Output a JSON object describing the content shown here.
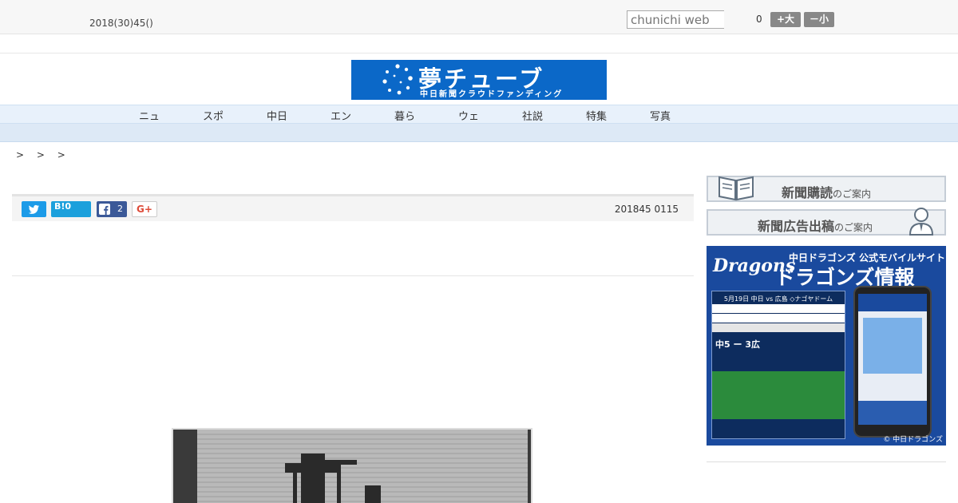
{
  "header": {
    "date_text": "2018(30)45()",
    "search_placeholder": "chunichi web",
    "font_size_value": "0",
    "font_bigger_label": "+大",
    "font_smaller_label": "－小"
  },
  "logo": {
    "main_text": "夢チューブ",
    "sub_text": "中日新聞クラウドファンディング"
  },
  "nav": {
    "items": [
      "ニュ",
      "スポ",
      "中日",
      "エン",
      "暮ら",
      "ウェ",
      "社説",
      "特集",
      "写真"
    ]
  },
  "breadcrumb": {
    "text": "> > >"
  },
  "article": {
    "share": {
      "hatena_label": "B!0",
      "facebook_count": "2",
      "gplus_label": "G+"
    },
    "published": "201845 0115"
  },
  "sidebar": {
    "subscribe_main": "新聞購読",
    "subscribe_small": "のご案内",
    "ads_main": "新聞広告出稿",
    "ads_small": "のご案内",
    "dragons_logo": "Dragons",
    "dragons_top": "中日ドラゴンズ 公式モバイルサイト",
    "dragons_title": "ドラゴンズ情報",
    "dragons_match": "5月19日 中日 vs 広島 ◇ナゴヤドーム",
    "dragons_score": "中5 ー 3広",
    "dragons_copy": "© 中日ドラゴンズ"
  },
  "colors": {
    "logo_bg": "#0b68c8",
    "nav_bg": "#e8f1fb",
    "twitter": "#1c9be8",
    "hatena": "#1ca0dc",
    "facebook": "#3b5998",
    "dragons_bg": "#1a4a9e"
  }
}
